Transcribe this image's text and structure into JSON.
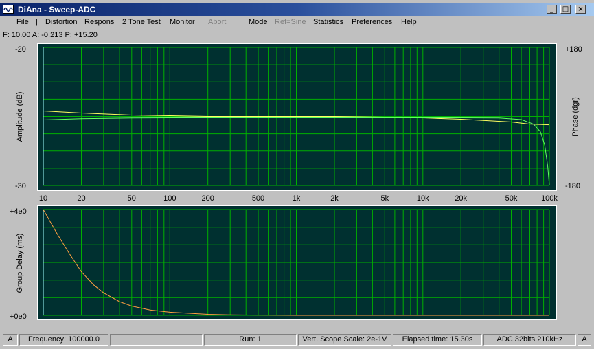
{
  "window": {
    "title": "DiAna - Sweep-ADC",
    "controls": {
      "minimize": "_",
      "maximize": "□",
      "close": "×"
    }
  },
  "menu": {
    "items": [
      {
        "label": "File",
        "enabled": true
      },
      {
        "label": "|",
        "separator": true
      },
      {
        "label": "Distortion",
        "enabled": true
      },
      {
        "label": "Respons",
        "enabled": true
      },
      {
        "label": "2 Tone Test",
        "enabled": true
      },
      {
        "label": "Monitor",
        "enabled": true
      },
      {
        "label": "Abort",
        "enabled": false
      },
      {
        "label": "|",
        "separator": true
      },
      {
        "label": "Mode",
        "enabled": true
      },
      {
        "label": "Ref=Sine",
        "enabled": false
      },
      {
        "label": "Statistics",
        "enabled": true
      },
      {
        "label": "Preferences",
        "enabled": true
      },
      {
        "label": "Help",
        "enabled": true
      }
    ]
  },
  "readout": "F: 10.00  A: -0.213  P: +15.20",
  "chart_data": [
    {
      "type": "line",
      "xscale": "log",
      "xlim": [
        10,
        100000
      ],
      "x_ticks": [
        10,
        20,
        50,
        100,
        200,
        500,
        1000,
        2000,
        5000,
        10000,
        20000,
        50000,
        100000
      ],
      "x_tick_labels": [
        "10",
        "20",
        "50",
        "100",
        "200",
        "500",
        "1k",
        "2k",
        "5k",
        "10k",
        "20k",
        "50k",
        "100k"
      ],
      "ylabel": "Amplitude (dB)",
      "ylim": [
        -30,
        -20
      ],
      "y_tick_labels": [
        "-20",
        "-30"
      ],
      "y2label": "Phase (dgr)",
      "y2lim": [
        -180,
        180
      ],
      "y2_tick_labels": [
        "+180",
        "-180"
      ],
      "grid": true,
      "colors": {
        "background": "#003030",
        "grid": "#00b000",
        "amplitude": "#ffff60",
        "phase": "#60ff60"
      },
      "series": [
        {
          "axis": "left",
          "x": [
            10,
            20,
            50,
            100,
            200,
            500,
            1000,
            2000,
            5000,
            10000,
            20000,
            50000,
            70000,
            100000
          ],
          "y": [
            -24.6,
            -24.75,
            -24.9,
            -24.95,
            -25.0,
            -25.0,
            -25.0,
            -25.0,
            -25.05,
            -25.1,
            -25.2,
            -25.4,
            -25.55,
            -25.6
          ]
        },
        {
          "axis": "right",
          "x": [
            10,
            20,
            50,
            100,
            200,
            500,
            1000,
            2000,
            5000,
            10000,
            20000,
            40000,
            60000,
            75000,
            85000,
            92000,
            97000,
            100000
          ],
          "y": [
            -9,
            -6,
            -4,
            -3.5,
            -3.5,
            -3.5,
            -3.5,
            -3.5,
            -3.5,
            -3.5,
            -3.5,
            -4,
            -8,
            -20,
            -40,
            -75,
            -130,
            -180
          ]
        }
      ]
    },
    {
      "type": "line",
      "xscale": "log",
      "xlim": [
        10,
        100000
      ],
      "x_ticks": [
        10,
        20,
        50,
        100,
        200,
        500,
        1000,
        2000,
        5000,
        10000,
        20000,
        50000,
        100000
      ],
      "ylabel": "Group Delay (ms)",
      "ylim": [
        0,
        4
      ],
      "y_tick_labels": [
        "+4e0",
        "+0e0"
      ],
      "grid": true,
      "colors": {
        "background": "#003030",
        "grid": "#00b000",
        "delay": "#ffa040"
      },
      "series": [
        {
          "x": [
            10,
            13,
            16,
            20,
            25,
            30,
            40,
            50,
            70,
            100,
            150,
            200,
            300,
            500,
            1000,
            100000
          ],
          "y": [
            4.0,
            3.05,
            2.35,
            1.65,
            1.15,
            0.85,
            0.52,
            0.35,
            0.2,
            0.12,
            0.07,
            0.04,
            0.02,
            0.01,
            0.0,
            0.0
          ]
        }
      ]
    }
  ],
  "status": {
    "left_letter": "A",
    "frequency": "Frequency: 100000.0",
    "blank": "",
    "run": "Run: 1",
    "scope": "Vert. Scope Scale: 2e-1V",
    "elapsed": "Elapsed time: 15.30s",
    "adc": "ADC 32bits 210kHz",
    "right_letter": "A"
  }
}
